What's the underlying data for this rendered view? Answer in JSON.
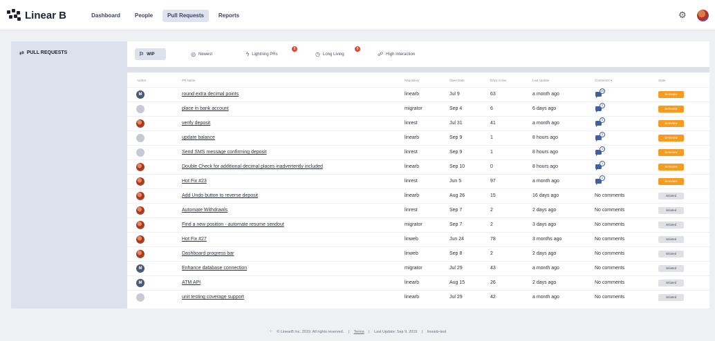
{
  "app": {
    "name": "Linear B"
  },
  "nav": {
    "items": [
      {
        "label": "Dashboard",
        "active": false
      },
      {
        "label": "People",
        "active": false
      },
      {
        "label": "Pull Requests",
        "active": true
      },
      {
        "label": "Reports",
        "active": false
      }
    ]
  },
  "sidebar": {
    "title": "PULL REQUESTS"
  },
  "tabs": [
    {
      "label": "WIP",
      "active": true,
      "icon": "flag-icon"
    },
    {
      "label": "Newest",
      "active": false,
      "icon": "new-icon"
    },
    {
      "label": "Lightning PRs",
      "active": false,
      "icon": "lightning-icon",
      "badge": "8"
    },
    {
      "label": "Long Living",
      "active": false,
      "icon": "clock-icon",
      "badge": "8"
    },
    {
      "label": "High Interaction",
      "active": false,
      "icon": "chat-icon"
    }
  ],
  "table": {
    "columns": [
      "Author",
      "PR Name",
      "Repository",
      "Open Date",
      "Days Active",
      "Last Update",
      "Comments ▾",
      "State"
    ],
    "rows": [
      {
        "author": "m",
        "author_initial": "M",
        "name": "round extra decimal points",
        "repo": "linearb",
        "open": "Jul 9",
        "days": "63",
        "update": "a month ago",
        "comments": "10",
        "state": "in-review"
      },
      {
        "author": "g",
        "author_initial": "",
        "name": "place in bank account",
        "repo": "migrator",
        "open": "Sep 4",
        "days": "6",
        "update": "6 days ago",
        "comments": "2",
        "state": "in-review"
      },
      {
        "author": "r",
        "author_initial": "",
        "name": "verify deposit",
        "repo": "linrest",
        "open": "Jul 31",
        "days": "41",
        "update": "a month ago",
        "comments": "2",
        "state": "in-review"
      },
      {
        "author": "g",
        "author_initial": "",
        "name": "update balance",
        "repo": "linearb",
        "open": "Sep 9",
        "days": "1",
        "update": "8 hours ago",
        "comments": "2",
        "state": "in-review"
      },
      {
        "author": "g",
        "author_initial": "",
        "name": "Send SMS message confirming deposit",
        "repo": "linrest",
        "open": "Sep 9",
        "days": "1",
        "update": "8 hours ago",
        "comments": "1",
        "state": "in-review"
      },
      {
        "author": "r",
        "author_initial": "",
        "name": "Double Check for additional decimal places inadvertently included",
        "repo": "linearb",
        "open": "Sep 10",
        "days": "0",
        "update": "8 hours ago",
        "comments": "1",
        "state": "in-review"
      },
      {
        "author": "r",
        "author_initial": "",
        "name": "Hot Fix #23",
        "repo": "linrest",
        "open": "Jun 5",
        "days": "97",
        "update": "a month ago",
        "comments": "1",
        "state": "in-review"
      },
      {
        "author": "r",
        "author_initial": "",
        "name": "Add Undo button to reverse deposit",
        "repo": "linearb",
        "open": "Aug 26",
        "days": "15",
        "update": "16 days ago",
        "comments": "No comments",
        "state": "initiated"
      },
      {
        "author": "r",
        "author_initial": "",
        "name": "Automate Withdrawls",
        "repo": "linrest",
        "open": "Sep 7",
        "days": "2",
        "update": "2 days ago",
        "comments": "No comments",
        "state": "initiated"
      },
      {
        "author": "r",
        "author_initial": "",
        "name": "Find a new position - automate resume sendout",
        "repo": "migrator",
        "open": "Sep 7",
        "days": "2",
        "update": "3 days ago",
        "comments": "No comments",
        "state": "initiated"
      },
      {
        "author": "r",
        "author_initial": "",
        "name": "Hot Fix #27",
        "repo": "linweb",
        "open": "Jun 24",
        "days": "78",
        "update": "3 months ago",
        "comments": "No comments",
        "state": "initiated"
      },
      {
        "author": "r",
        "author_initial": "",
        "name": "Dashboard progress bar",
        "repo": "linweb",
        "open": "Sep 8",
        "days": "2",
        "update": "2 days ago",
        "comments": "No comments",
        "state": "initiated"
      },
      {
        "author": "m",
        "author_initial": "M",
        "name": "Enhance database connection",
        "repo": "migrator",
        "open": "Jul 29",
        "days": "43",
        "update": "a month ago",
        "comments": "No comments",
        "state": "initiated"
      },
      {
        "author": "m",
        "author_initial": "M",
        "name": "ATM API",
        "repo": "linearb",
        "open": "Aug 15",
        "days": "26",
        "update": "2 days ago",
        "comments": "No comments",
        "state": "initiated"
      },
      {
        "author": "g",
        "author_initial": "",
        "name": "unit testing coverage support",
        "repo": "linearb",
        "open": "Jul 29",
        "days": "42",
        "update": "a month ago",
        "comments": "No comments",
        "state": "initiated"
      }
    ]
  },
  "footer": {
    "copyright": "© LinearB Inc. 2019. All rights reserved.",
    "terms": "Terms",
    "last_update": "Last Update: Sep 9, 2019",
    "org": "linearb-test"
  },
  "colors": {
    "wip": "#f59b1f",
    "badge": "#d9472c",
    "accent": "#3f5fa8"
  }
}
